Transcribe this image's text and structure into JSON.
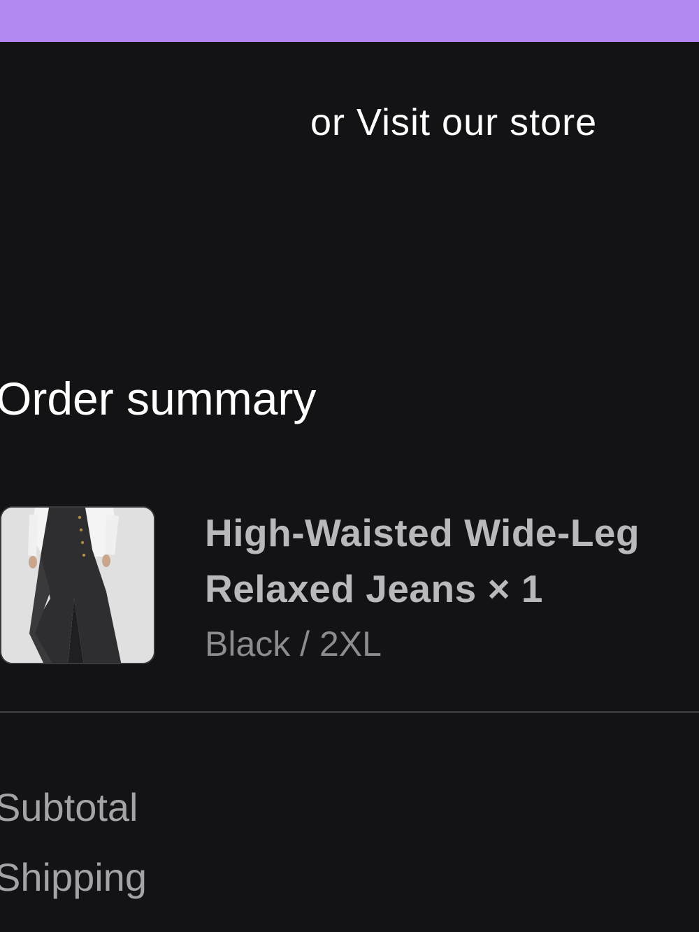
{
  "top_bar": {
    "color": "#b388f2"
  },
  "visit_store": {
    "label": "or Visit our store"
  },
  "order_summary": {
    "title": "Order summary",
    "items": [
      {
        "name": "High-Waisted Wide-Leg Relaxed Jeans × 1",
        "variant": "Black / 2XL",
        "image": "product-thumbnail"
      }
    ],
    "lines": [
      {
        "label": "Subtotal"
      },
      {
        "label": "Shipping"
      }
    ]
  }
}
